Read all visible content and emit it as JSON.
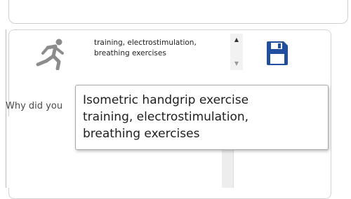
{
  "colors": {
    "accent_blue": "#1f4f9e",
    "runner_icon": "#8c8c8c",
    "border": "#cfcfcf"
  },
  "icons": {
    "activity": "running-person-icon",
    "save": "floppy-disk-icon",
    "scroll_up": "chevron-up-icon",
    "scroll_down": "chevron-down-icon"
  },
  "activity_field": {
    "value": "training, electrostimulation,\nbreathing exercises"
  },
  "question": {
    "label": "Why did you"
  },
  "tooltip": {
    "text": "Isometric handgrip exercise\ntraining, electrostimulation,\nbreathing exercises"
  }
}
